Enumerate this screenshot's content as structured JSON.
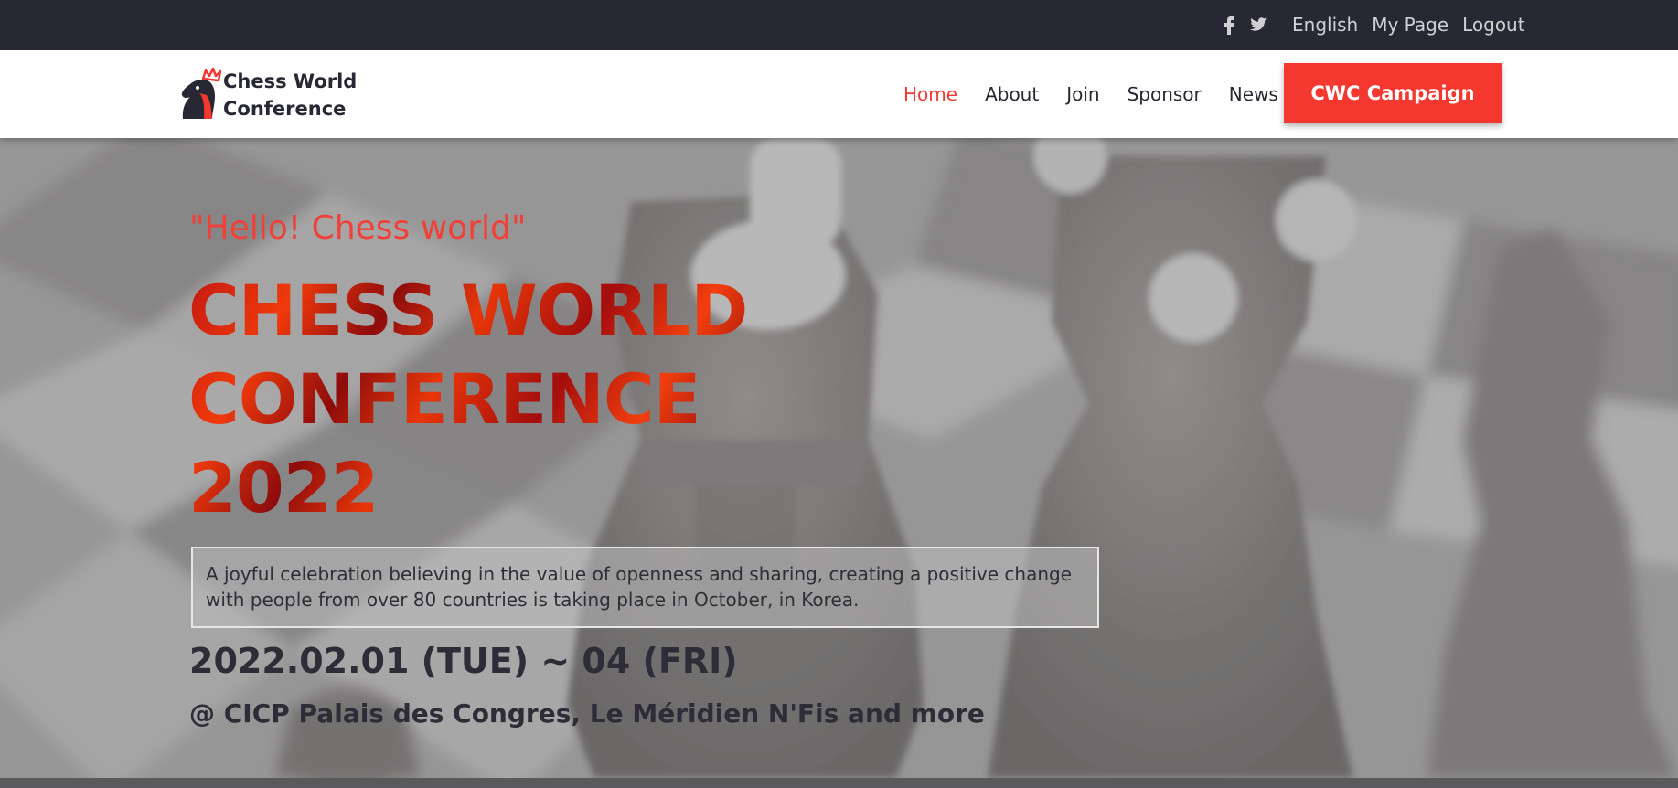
{
  "topbar": {
    "social": [
      "facebook-icon",
      "twitter-icon"
    ],
    "links": [
      "English",
      "My Page",
      "Logout"
    ]
  },
  "header": {
    "logo_line1": "Chess World",
    "logo_line2": "Conference",
    "nav": [
      "Home",
      "About",
      "Join",
      "Sponsor",
      "News"
    ],
    "active_nav": "Home",
    "cta_label": "CWC Campaign"
  },
  "hero": {
    "tagline": "\"Hello! Chess world\"",
    "title_line1": "CHESS WORLD",
    "title_line2": "CONFERENCE",
    "title_line3": "2022",
    "description": "A joyful celebration believing in the value of openness and sharing, creating a positive change with people from over 80 countries is taking place in October, in Korea.",
    "date": "2022.02.01 (TUE) ~ 04 (FRI)",
    "venue": "@ CICP Palais des Congres, Le Méridien N'Fis and more"
  },
  "colors": {
    "topbar_bg": "#272833",
    "accent": "#f4372f",
    "text_dark": "#272833"
  }
}
